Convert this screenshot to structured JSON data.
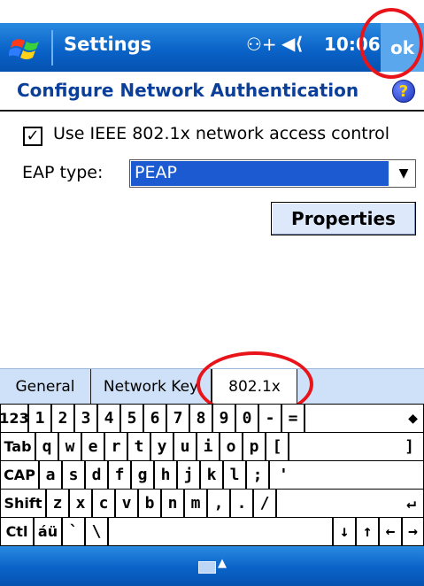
{
  "titlebar": {
    "title": "Settings",
    "connectivity_glyph": "⚇+",
    "volume_glyph": "◀⟨",
    "time": "10:06",
    "ok_label": "ok"
  },
  "page": {
    "heading": "Configure Network Authentication",
    "help_glyph": "?"
  },
  "form": {
    "checkbox_mark": "✓",
    "checkbox_label": "Use IEEE 802.1x network access control",
    "eap_label": "EAP type:",
    "eap_value": "PEAP",
    "dropdown_arrow": "▼",
    "properties_label": "Properties"
  },
  "tabs": [
    {
      "label": "General"
    },
    {
      "label": "Network Key"
    },
    {
      "label": "802.1x"
    }
  ],
  "keyboard": {
    "rows": [
      [
        "123",
        "1",
        "2",
        "3",
        "4",
        "5",
        "6",
        "7",
        "8",
        "9",
        "0",
        "-",
        "=",
        "◆"
      ],
      [
        "Tab",
        "q",
        "w",
        "e",
        "r",
        "t",
        "y",
        "u",
        "i",
        "o",
        "p",
        "[",
        "]"
      ],
      [
        "CAP",
        "a",
        "s",
        "d",
        "f",
        "g",
        "h",
        "j",
        "k",
        "l",
        ";",
        "'"
      ],
      [
        "Shift",
        "z",
        "x",
        "c",
        "v",
        "b",
        "n",
        "m",
        ",",
        ".",
        "/",
        "↵"
      ],
      [
        "Ctl",
        "áü",
        "`",
        "\\",
        "",
        "↓",
        "↑",
        "←",
        "→"
      ]
    ]
  },
  "bottombar": {
    "sip_arrow": "▲"
  }
}
